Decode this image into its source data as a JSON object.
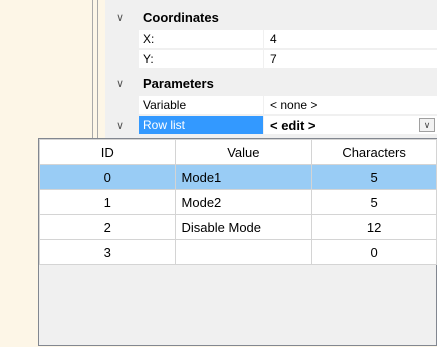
{
  "property_grid": {
    "coordinates": {
      "label": "Coordinates",
      "x_label": "X:",
      "x_value": "4",
      "y_label": "Y:",
      "y_value": "7"
    },
    "parameters": {
      "label": "Parameters",
      "variable_label": "Variable",
      "variable_value": "< none >",
      "row_list_label": "Row list",
      "row_list_value": "< edit >"
    }
  },
  "row_table": {
    "columns": [
      "ID",
      "Value",
      "Characters"
    ],
    "rows": [
      {
        "id": "0",
        "value": "Mode1",
        "characters": "5",
        "selected": true
      },
      {
        "id": "1",
        "value": "Mode2",
        "characters": "5",
        "selected": false
      },
      {
        "id": "2",
        "value": "Disable Mode",
        "characters": "12",
        "selected": false
      },
      {
        "id": "3",
        "value": "",
        "characters": "0",
        "selected": false
      }
    ]
  },
  "icons": {
    "expander": "chevron-down-icon",
    "dropdown": "dropdown-arrow-icon"
  }
}
